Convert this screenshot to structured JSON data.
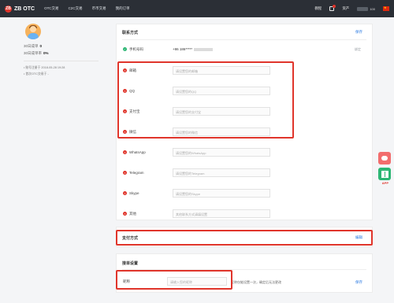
{
  "header": {
    "logo_badge": "ZB",
    "logo_text": "ZB OTC",
    "nav": [
      "OTC交易",
      "C2C交易",
      "币币交易",
      "我的订单"
    ],
    "right": {
      "tutorial": "教程",
      "assets": "资产",
      "asset_count": "100"
    }
  },
  "profile": {
    "stat1_label": "30日成单",
    "stat1_value": "0",
    "stat2_label": "30日成单率",
    "stat2_value": "0%",
    "meta1": "• 账号注册于 2018-05-28 19:28",
    "meta2": "• 首次OTC交易于 -"
  },
  "contact": {
    "title": "联系方式",
    "save": "保存",
    "phone_label": "手机号码",
    "phone_value": "+86 186*****",
    "phone_edit": "绑定",
    "rows": [
      {
        "label": "邮箱",
        "placeholder": "请设置您的邮箱"
      },
      {
        "label": "QQ",
        "placeholder": "请设置您的QQ"
      },
      {
        "label": "支付宝",
        "placeholder": "请设置您的支付宝"
      },
      {
        "label": "微信",
        "placeholder": "请设置您的微信"
      },
      {
        "label": "WhatsApp",
        "placeholder": "请设置您的WhatsApp"
      },
      {
        "label": "Telegram",
        "placeholder": "请设置您的Telegram"
      },
      {
        "label": "Skype",
        "placeholder": "请设置您的Skype"
      },
      {
        "label": "其他",
        "placeholder": "其他联系方式请填设置"
      }
    ]
  },
  "payment": {
    "title": "支付方式",
    "edit": "编辑"
  },
  "order": {
    "title": "接单设置",
    "nickname_label": "昵称",
    "nickname_placeholder": "请输入您的昵称",
    "hint": "昵称仅能设置一次，确定后无法更改",
    "save": "保存"
  },
  "side": {
    "app_label": "APP"
  }
}
